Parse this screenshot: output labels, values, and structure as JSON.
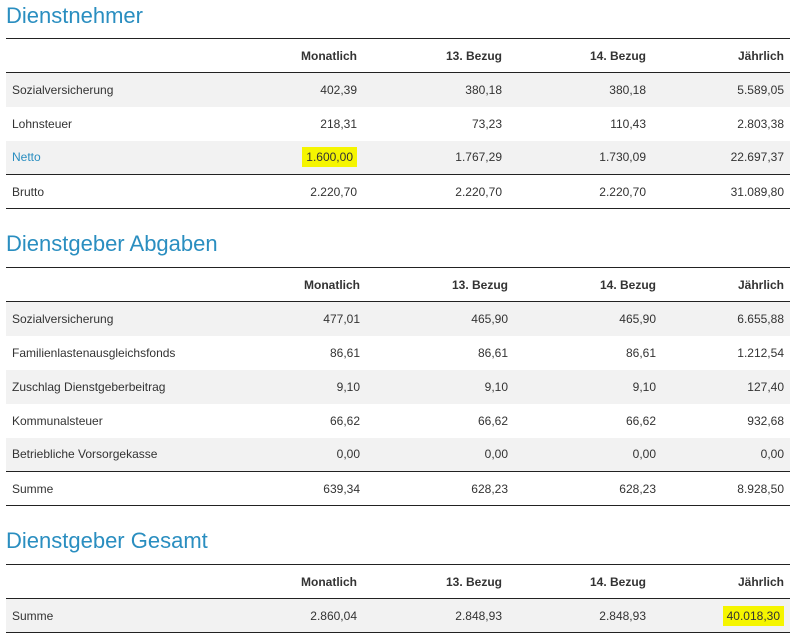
{
  "sections": [
    {
      "title": "Dienstnehmer",
      "headers": [
        "",
        "Monatlich",
        "13. Bezug",
        "14. Bezug",
        "Jährlich"
      ],
      "rows": [
        {
          "label": "Sozialversicherung",
          "values": [
            "402,39",
            "380,18",
            "380,18",
            "5.589,05"
          ]
        },
        {
          "label": "Lohnsteuer",
          "values": [
            "218,31",
            "73,23",
            "110,43",
            "2.803,38"
          ]
        },
        {
          "label": "Netto",
          "values": [
            "1.600,00",
            "1.767,29",
            "1.730,09",
            "22.697,37"
          ]
        },
        {
          "label": "Brutto",
          "values": [
            "2.220,70",
            "2.220,70",
            "2.220,70",
            "31.089,80"
          ]
        }
      ]
    },
    {
      "title": "Dienstgeber Abgaben",
      "headers": [
        "",
        "Monatlich",
        "13. Bezug",
        "14. Bezug",
        "Jährlich"
      ],
      "rows": [
        {
          "label": "Sozialversicherung",
          "values": [
            "477,01",
            "465,90",
            "465,90",
            "6.655,88"
          ]
        },
        {
          "label": "Familienlastenausgleichsfonds",
          "values": [
            "86,61",
            "86,61",
            "86,61",
            "1.212,54"
          ]
        },
        {
          "label": "Zuschlag Dienstgeberbeitrag",
          "values": [
            "9,10",
            "9,10",
            "9,10",
            "127,40"
          ]
        },
        {
          "label": "Kommunalsteuer",
          "values": [
            "66,62",
            "66,62",
            "66,62",
            "932,68"
          ]
        },
        {
          "label": "Betriebliche Vorsorgekasse",
          "values": [
            "0,00",
            "0,00",
            "0,00",
            "0,00"
          ]
        },
        {
          "label": "Summe",
          "values": [
            "639,34",
            "628,23",
            "628,23",
            "8.928,50"
          ]
        }
      ]
    },
    {
      "title": "Dienstgeber Gesamt",
      "headers": [
        "",
        "Monatlich",
        "13. Bezug",
        "14. Bezug",
        "Jährlich"
      ],
      "rows": [
        {
          "label": "Summe",
          "values": [
            "2.860,04",
            "2.848,93",
            "2.848,93",
            "40.018,30"
          ]
        }
      ]
    }
  ],
  "colors": {
    "accent": "#2a8ec0",
    "highlight": "#f5f500",
    "row_alt": "#f2f2f2"
  }
}
